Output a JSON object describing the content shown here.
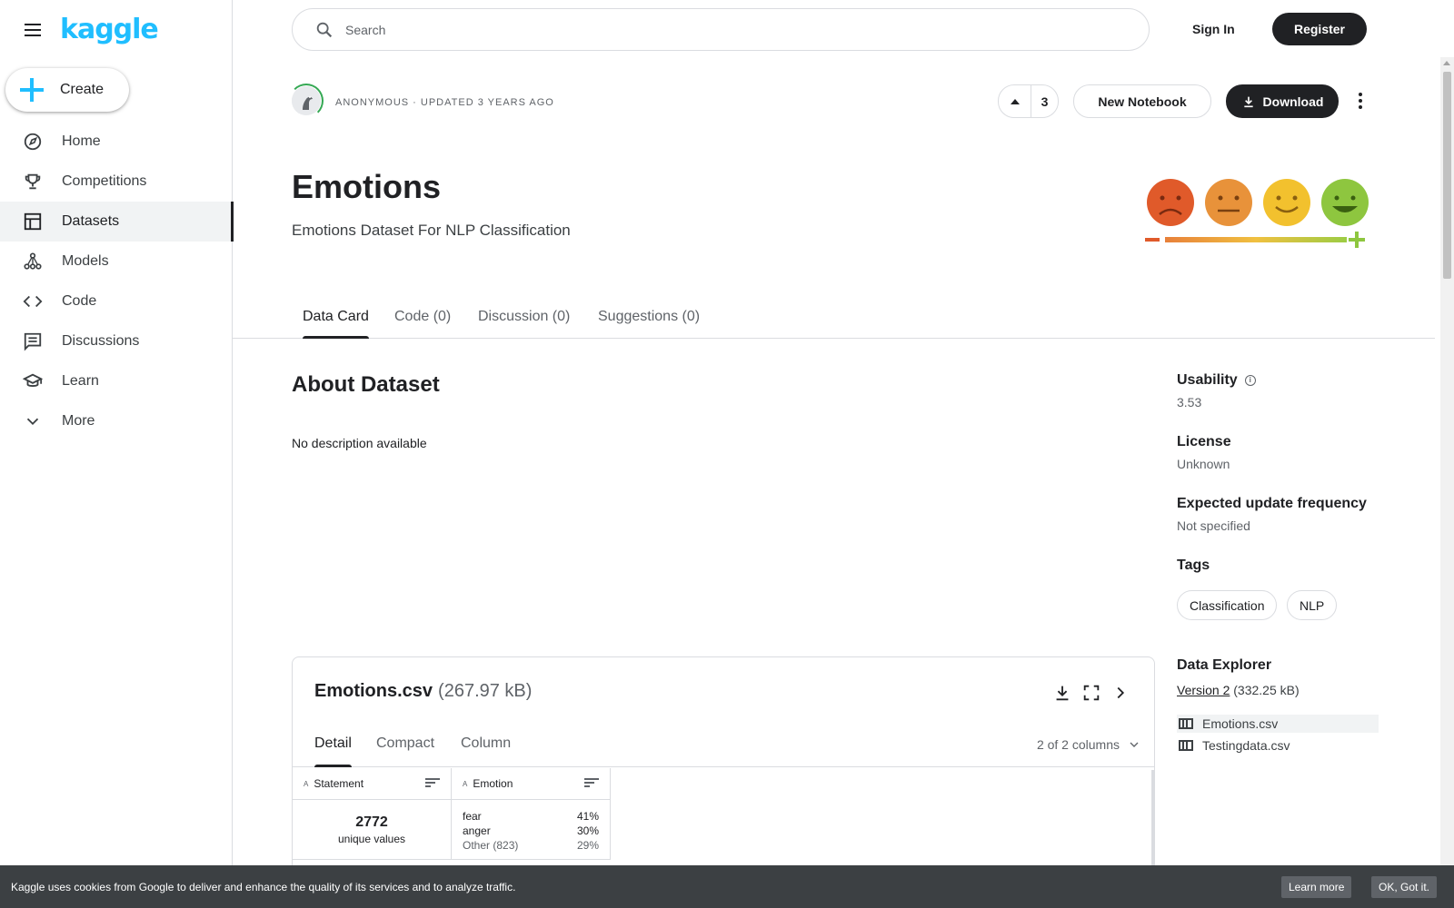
{
  "sidebar": {
    "logo": "kaggle",
    "create_label": "Create",
    "items": [
      {
        "label": "Home",
        "icon": "compass-icon"
      },
      {
        "label": "Competitions",
        "icon": "trophy-icon"
      },
      {
        "label": "Datasets",
        "icon": "table-icon",
        "active": true
      },
      {
        "label": "Models",
        "icon": "models-icon"
      },
      {
        "label": "Code",
        "icon": "code-icon"
      },
      {
        "label": "Discussions",
        "icon": "comment-icon"
      },
      {
        "label": "Learn",
        "icon": "school-icon"
      },
      {
        "label": "More",
        "icon": "chevron-down-icon"
      }
    ]
  },
  "header": {
    "search_placeholder": "Search",
    "signin_label": "Sign In",
    "register_label": "Register"
  },
  "dataset": {
    "meta": "Anonymous · Updated 3 years ago",
    "upvotes": "3",
    "new_notebook_label": "New Notebook",
    "download_label": "Download",
    "title": "Emotions",
    "subtitle": "Emotions Dataset For NLP Classification",
    "tabs": [
      "Data Card",
      "Code (0)",
      "Discussion (0)",
      "Suggestions (0)"
    ],
    "about_heading": "About Dataset",
    "about_text": "No description available"
  },
  "side": {
    "usability_label": "Usability",
    "usability_value": "3.53",
    "license_label": "License",
    "license_value": "Unknown",
    "frequency_label": "Expected update frequency",
    "frequency_value": "Not specified",
    "tags_label": "Tags",
    "tags": [
      "Classification",
      "NLP"
    ],
    "explorer_label": "Data Explorer",
    "version_link": "Version 2",
    "version_size": "(332.25 kB)",
    "files": [
      "Emotions.csv",
      "Testingdata.csv"
    ]
  },
  "explorer": {
    "file_name": "Emotions.csv",
    "file_size": "(267.97 kB)",
    "tabs": [
      "Detail",
      "Compact",
      "Column"
    ],
    "columns_selector": "2 of 2 columns",
    "columns": [
      {
        "name": "Statement",
        "unique_count": "2772",
        "unique_label": "unique values"
      },
      {
        "name": "Emotion",
        "distribution": [
          {
            "label": "fear",
            "pct": "41%"
          },
          {
            "label": "anger",
            "pct": "30%"
          },
          {
            "label": "Other (823)",
            "pct": "29%"
          }
        ]
      }
    ]
  },
  "cookie": {
    "message": "Kaggle uses cookies from Google to deliver and enhance the quality of its services and to analyze traffic.",
    "learn_more": "Learn more",
    "ok": "OK, Got it."
  },
  "colors": {
    "brand": "#20beff",
    "dark_button": "#202124",
    "cookie_bg": "#3c4043"
  }
}
